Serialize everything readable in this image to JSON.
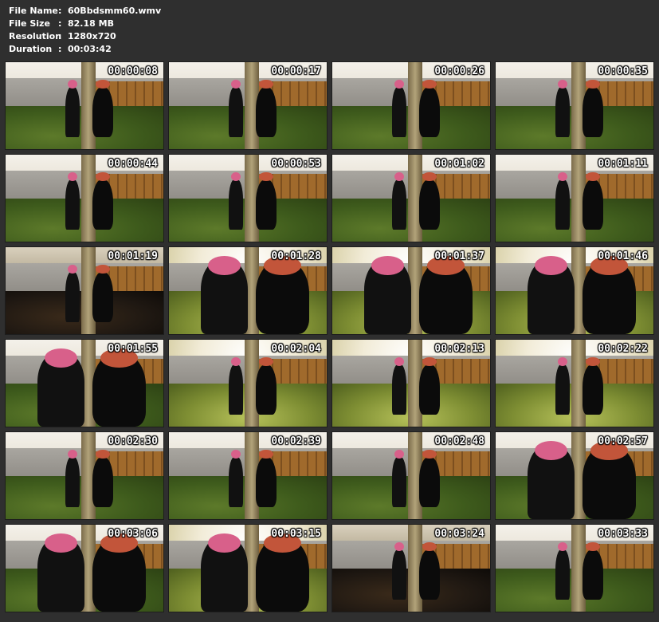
{
  "file_info": [
    {
      "key": "File Name",
      "value": "60Bbdsmm60.wmv"
    },
    {
      "key": "File Size",
      "value": "82.18 MB"
    },
    {
      "key": "Resolution",
      "value": "1280x720"
    },
    {
      "key": "Duration",
      "value": "00:03:42"
    }
  ],
  "separator": ":",
  "thumbnails": [
    {
      "time": "00:00:08",
      "scene": "wide"
    },
    {
      "time": "00:00:17",
      "scene": "wide"
    },
    {
      "time": "00:00:26",
      "scene": "wide"
    },
    {
      "time": "00:00:35",
      "scene": "wide"
    },
    {
      "time": "00:00:44",
      "scene": "wide"
    },
    {
      "time": "00:00:53",
      "scene": "mid"
    },
    {
      "time": "00:01:02",
      "scene": "mid"
    },
    {
      "time": "00:01:11",
      "scene": "mid"
    },
    {
      "time": "00:01:19",
      "scene": "dark"
    },
    {
      "time": "00:01:28",
      "scene": "close bright"
    },
    {
      "time": "00:01:37",
      "scene": "close bright"
    },
    {
      "time": "00:01:46",
      "scene": "close bright"
    },
    {
      "time": "00:01:55",
      "scene": "close"
    },
    {
      "time": "00:02:04",
      "scene": "bright"
    },
    {
      "time": "00:02:13",
      "scene": "bright"
    },
    {
      "time": "00:02:22",
      "scene": "bright"
    },
    {
      "time": "00:02:30",
      "scene": "wide"
    },
    {
      "time": "00:02:39",
      "scene": "wide"
    },
    {
      "time": "00:02:48",
      "scene": "wide"
    },
    {
      "time": "00:02:57",
      "scene": "close"
    },
    {
      "time": "00:03:06",
      "scene": "close"
    },
    {
      "time": "00:03:15",
      "scene": "close bright"
    },
    {
      "time": "00:03:24",
      "scene": "dark"
    },
    {
      "time": "00:03:33",
      "scene": "wide"
    }
  ]
}
